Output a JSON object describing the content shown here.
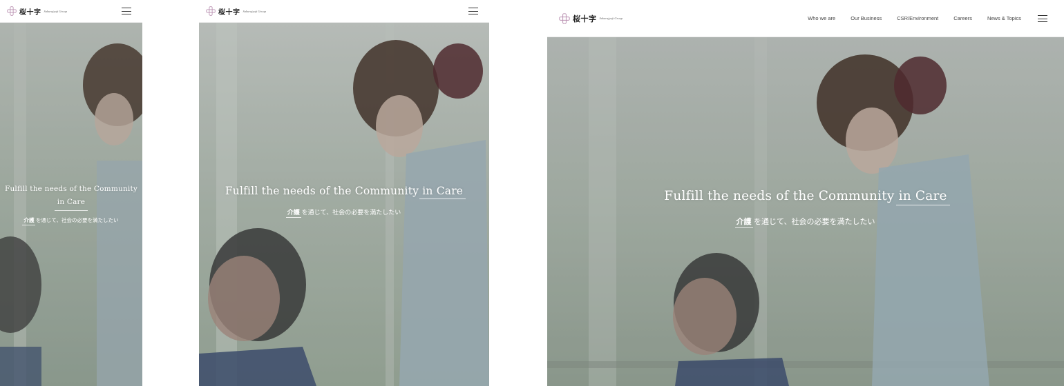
{
  "brand": {
    "name_jp": "桜十字",
    "name_en": "Sakurajyuji Group",
    "accent_color": "#b98fb0"
  },
  "nav": {
    "items": [
      "Who we are",
      "Our Business",
      "CSR/Environment",
      "Careers",
      "News & Topics"
    ]
  },
  "hero": {
    "headline": "Fulfill the needs of the Community",
    "headline_emphasis": "in Care",
    "subline_emphasis": "介護",
    "subline_rest": "を通じて、社会の必要を満たしたい"
  },
  "icons": {
    "logo": "sakura-cross-logo-icon",
    "menu": "hamburger-menu-icon"
  }
}
